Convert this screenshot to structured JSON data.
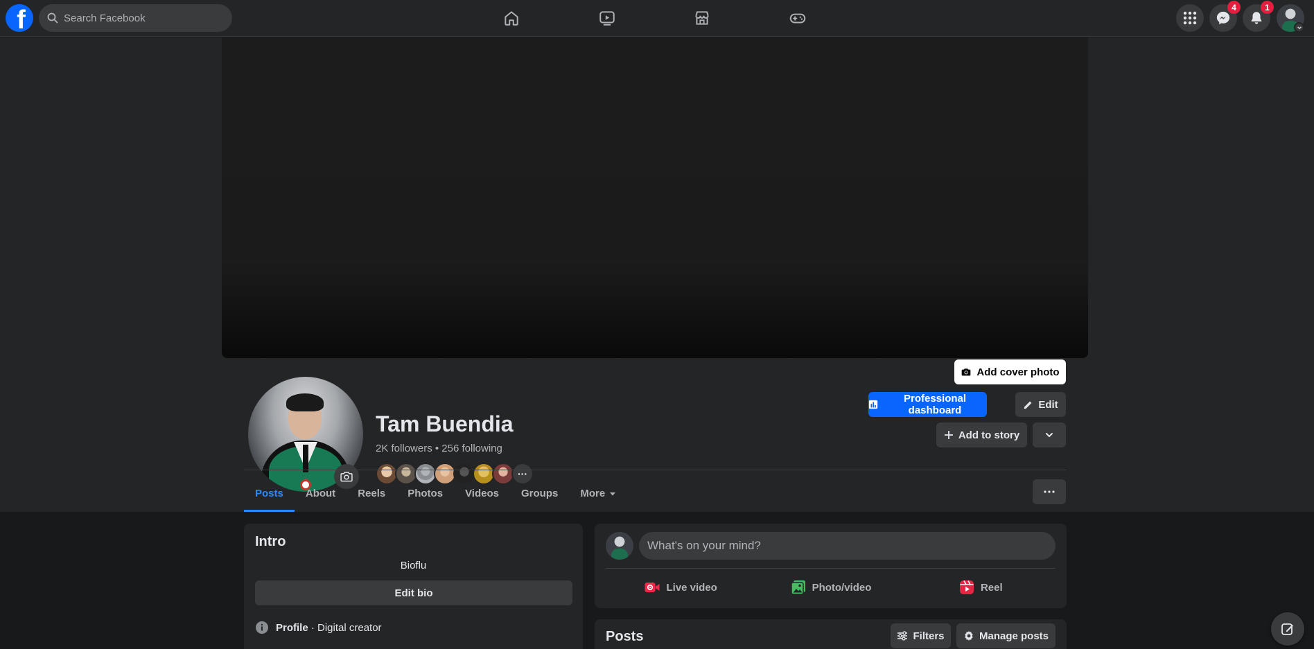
{
  "topbar": {
    "search_placeholder": "Search Facebook",
    "nav": [
      "home-icon",
      "watch-icon",
      "marketplace-icon",
      "gaming-icon"
    ],
    "messenger_badge": "4",
    "notifications_badge": "1"
  },
  "profile": {
    "add_cover_label": "Add cover photo",
    "name": "Tam Buendia",
    "stats": "2K followers • 256 following",
    "friends_more": "···",
    "professional_dashboard_label": "Professional dashboard",
    "edit_label": "Edit",
    "add_to_story_label": "Add to story"
  },
  "tabs": {
    "posts": "Posts",
    "about": "About",
    "reels": "Reels",
    "photos": "Photos",
    "videos": "Videos",
    "groups": "Groups",
    "more": "More"
  },
  "intro": {
    "title": "Intro",
    "bio": "Bioflu",
    "edit_bio_label": "Edit bio",
    "profile_label": "Profile",
    "profile_value": " · Digital creator"
  },
  "composer": {
    "placeholder": "What's on your mind?",
    "live_video_label": "Live video",
    "photo_video_label": "Photo/video",
    "reel_label": "Reel"
  },
  "posts_section": {
    "title": "Posts",
    "filters_label": "Filters",
    "manage_posts_label": "Manage posts"
  },
  "colors": {
    "accent": "#0866ff",
    "active_tab": "#2d88ff",
    "badge": "#e41e3f",
    "live_video": "#f02849",
    "photo_video": "#45bd62",
    "reel": "#e42645"
  }
}
